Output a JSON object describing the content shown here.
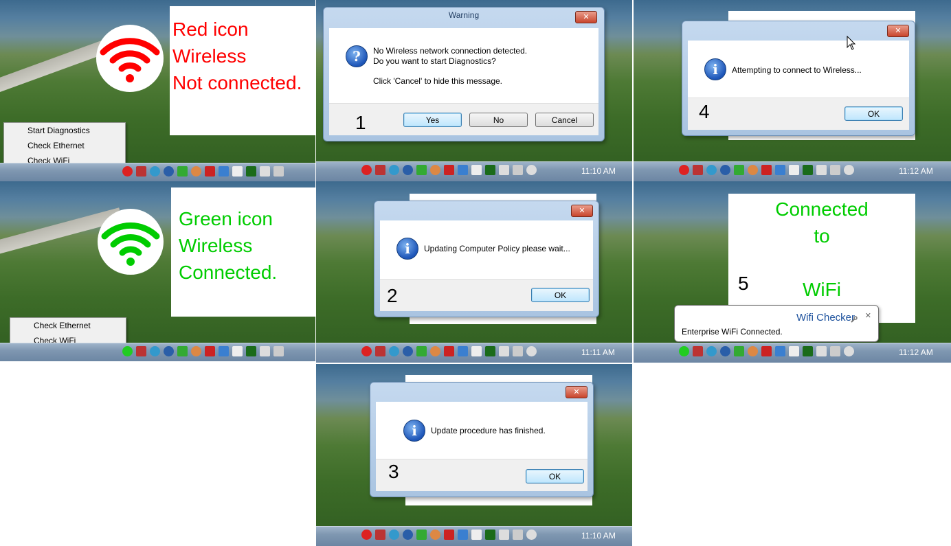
{
  "panel_red": {
    "title_line1": "Red icon",
    "title_line2": "Wireless",
    "title_line3": "Not connected.",
    "menu": [
      "Start Diagnostics",
      "Check Ethernet",
      "Check WiFi"
    ],
    "color": "#ff0000"
  },
  "panel_green": {
    "title_line1": "Green icon",
    "title_line2": "Wireless",
    "title_line3": "Connected.",
    "menu": [
      "Check Ethernet",
      "Check WiFi"
    ],
    "color": "#00cc00"
  },
  "step1": {
    "number": "1",
    "title": "Warning",
    "close": "✕",
    "line1": "No  Wireless network connection detected.",
    "line2": "Do you want to start Diagnostics?",
    "line3": "Click 'Cancel' to hide this message.",
    "yes": "Yes",
    "no": "No",
    "cancel": "Cancel",
    "clock": "11:10 AM"
  },
  "step2": {
    "number": "2",
    "close": "✕",
    "message": "Updating Computer Policy please wait...",
    "ok": "OK",
    "clock": "11:11 AM"
  },
  "step3": {
    "number": "3",
    "close": "✕",
    "message": "Update procedure has finished.",
    "ok": "OK",
    "clock": "11:10 AM"
  },
  "step4": {
    "number": "4",
    "close": "✕",
    "message": "Attempting to connect to  Wireless...",
    "ok": "OK",
    "clock": "11:12 AM"
  },
  "step5": {
    "number": "5",
    "line1": "Connected",
    "line2": "to",
    "line3": "WiFi",
    "balloon_title": "Wifi Checker",
    "balloon_text": "Enterprise WiFi Connected.",
    "balloon_close": "✕",
    "clock": "11:12 AM"
  },
  "info_glyph": "i",
  "question_glyph": "?"
}
